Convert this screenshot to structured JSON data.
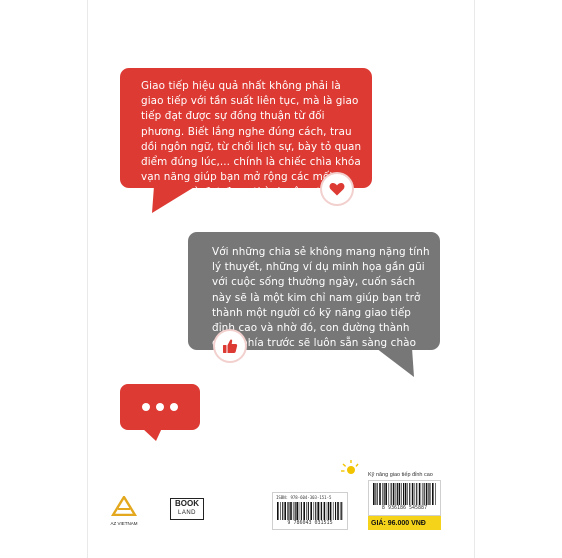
{
  "bubble1": {
    "text": "Giao tiếp hiệu quả nhất không phải là giao tiếp với tần suất liên tục, mà là giao tiếp đạt được sự đồng thuận từ đối phương. Biết lắng nghe đúng cách, trau dồi ngôn ngữ, từ chối lịch sự, bày tỏ quan điểm đúng lúc,... chính là chiếc chìa khóa vạn năng giúp bạn mở rộng các mối quan hệ và đạt được thành công trong cuộc sống hiện đại."
  },
  "bubble2": {
    "text": "Với những chia sẻ không mang nặng tính lý thuyết, những ví dụ minh họa gần gũi với cuộc sống thường ngày, cuốn sách này sẽ là một kim chỉ nam giúp bạn trở thành một người có kỹ năng giao tiếp đỉnh cao và nhờ đó, con đường thành công phía trước sẽ luôn sẵn sàng chào đón bạn!"
  },
  "icons": {
    "heart": "heart-icon",
    "thumbs_up": "thumbs-up-icon",
    "dots": "ellipsis-icon",
    "sun": "sun-icon"
  },
  "publisher": {
    "az_name": "AZ VIETNAM",
    "bookland_line1": "BOOK",
    "bookland_line2": "LAND"
  },
  "barcode_left": {
    "isbn_label": "ISBN: 978-604-303-151-5",
    "digits": "9 786043 031515"
  },
  "barcode_right": {
    "title": "Kỹ năng giao tiếp đỉnh cao",
    "digits": "8 936186 545887",
    "price": "GIÁ: 96.000 VNĐ"
  },
  "colors": {
    "red": "#dd3a33",
    "gray": "#777777",
    "price_yellow": "#f4d31a"
  }
}
